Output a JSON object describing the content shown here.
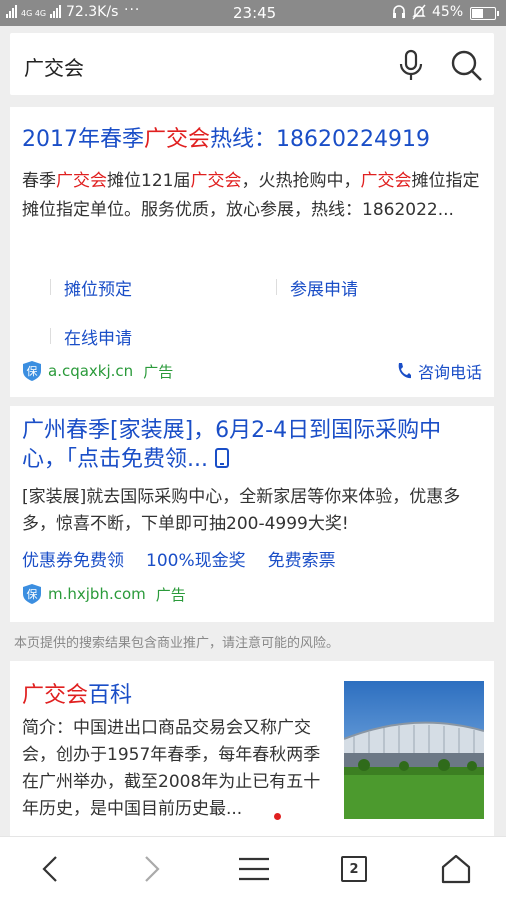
{
  "status_bar": {
    "network_type": "4G 4G",
    "speed": "72.3K/s",
    "more": "···",
    "time": "23:45",
    "battery": "45%",
    "battery_level": 0.45
  },
  "search": {
    "query": "广交会"
  },
  "result1": {
    "title_prefix": "2017年春季",
    "title_keyword": "广交会",
    "title_suffix": "热线：18620224919",
    "body_part1": "春季",
    "body_kw1": "广交会",
    "body_part2": "摊位121届",
    "body_kw2": "广交会",
    "body_part3": "，火热抢购中，",
    "body_kw3": "广交会",
    "body_part4": "摊位指定摊位指定单位。服务优质，放心参展，热线：1862022...",
    "sitelinks": [
      "摊位预定",
      "参展申请",
      "在线申请"
    ],
    "domain": "a.cqaxkj.cn",
    "ad_label": "广告",
    "shield_label": "保",
    "consult": "咨询电话"
  },
  "result2": {
    "title": "广州春季[家装展]，6月2-4日到国际采购中心，「点击免费领...",
    "body": "[家装展]就去国际采购中心，全新家居等你来体验，优惠多多，惊喜不断，下单即可抽200-4999大奖!",
    "links": [
      "优惠券免费领",
      "100%现金奖",
      "免费索票"
    ],
    "domain": "m.hxjbh.com",
    "ad_label": "广告",
    "shield_label": "保"
  },
  "disclaimer": "本页提供的搜索结果包含商业推广，请注意可能的风险。",
  "result3": {
    "title_keyword": "广交会",
    "title_suffix": "百科",
    "body": "简介：中国进出口商品交易会又称广交会，创办于1957年春季，每年春秋两季在广州举办，截至2008年为止已有五十年历史，是中国目前历史最..."
  },
  "bottom_nav": {
    "tab_count": "2"
  },
  "colors": {
    "link_blue": "#1a4ec7",
    "keyword_red": "#e02020",
    "source_green": "#2a9a3a"
  }
}
